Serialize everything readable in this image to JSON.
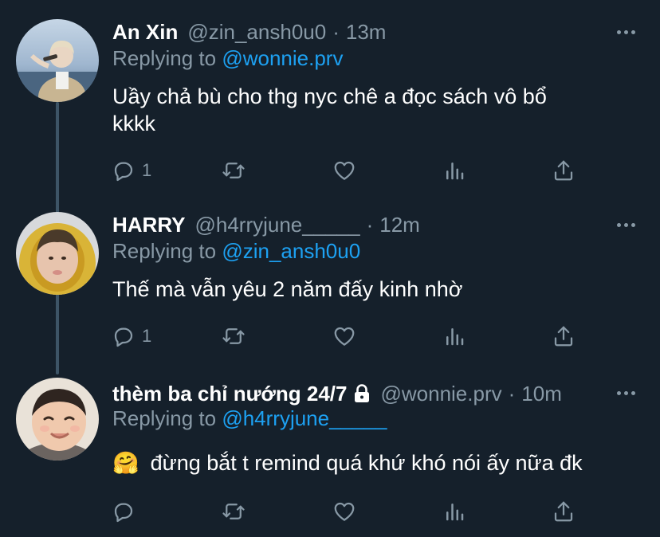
{
  "tweets": [
    {
      "name": "An Xin",
      "handle": "@zin_ansh0u0",
      "time": "13m",
      "replying_prefix": "Replying to ",
      "replying_to": "@wonnie.prv",
      "lines": [
        "Uầy chả bù cho thg nyc chê a đọc sách vô bổ",
        "kkkk"
      ],
      "reply_count": "1",
      "locked": false
    },
    {
      "name": "HARRY",
      "handle": "@h4rryjune_____",
      "time": "12m",
      "replying_prefix": "Replying to ",
      "replying_to": "@zin_ansh0u0",
      "lines": [
        "Thế mà vẫn yêu 2 năm đấy kinh nhờ"
      ],
      "reply_count": "1",
      "locked": false
    },
    {
      "name": "thèm ba chỉ nướng 24/7",
      "handle": "@wonnie.prv",
      "time": "10m",
      "replying_prefix": "Replying to ",
      "replying_to": "@h4rryjune_____",
      "emoji": "🤗",
      "lines": [
        "đừng bắt t remind quá khứ khó nói ấy nữa đk"
      ],
      "reply_count": "",
      "locked": true
    }
  ],
  "separator": "·",
  "icons": [
    "reply-icon",
    "retweet-icon",
    "like-icon",
    "analytics-icon",
    "share-icon",
    "more-icon",
    "lock-icon"
  ],
  "colors": {
    "background": "#15202b",
    "link": "#1da1f2",
    "muted": "#8899a6",
    "text": "#ffffff"
  }
}
